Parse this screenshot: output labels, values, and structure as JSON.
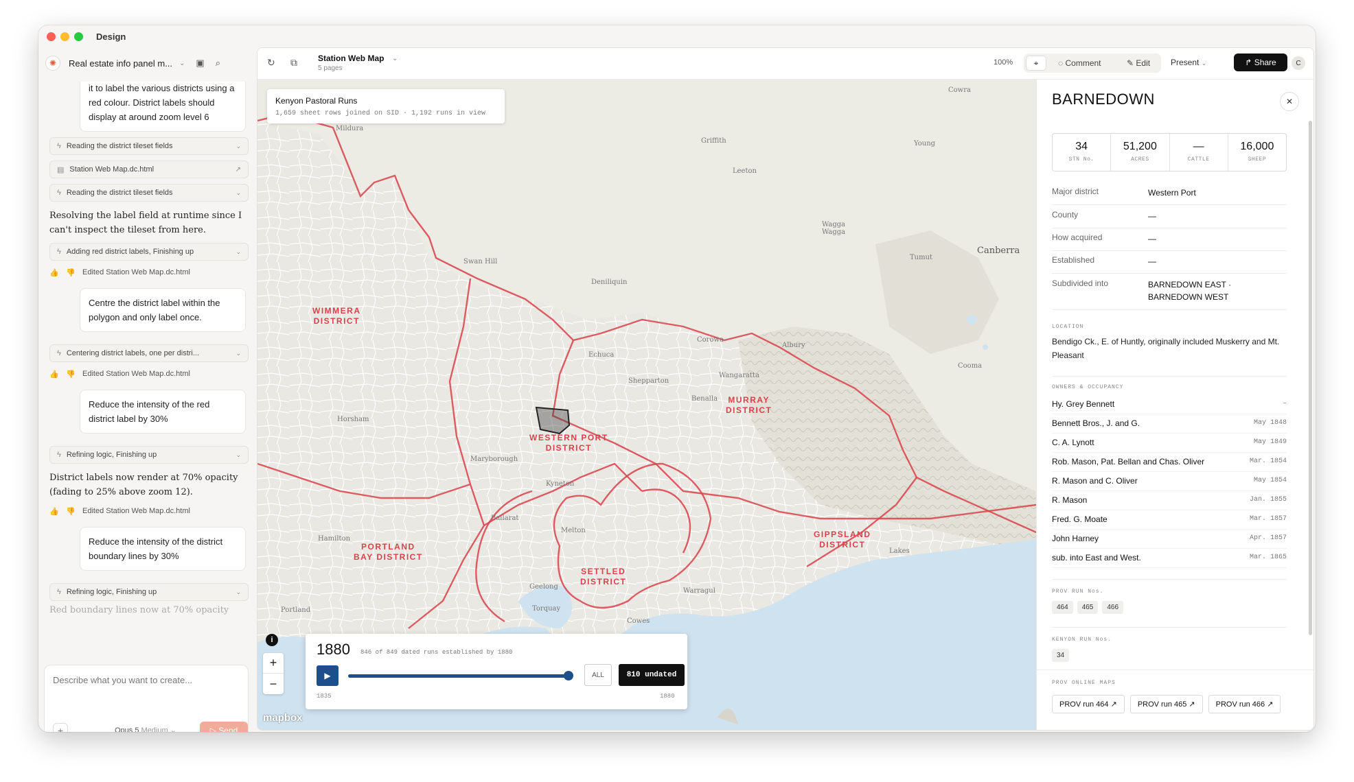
{
  "window": {
    "title": "Design"
  },
  "chat": {
    "project_title": "Real estate info panel m...",
    "messages": {
      "user1": "it to label the various districts using a red colour. District labels should display at around zoom level 6",
      "tool1": "Reading the district tileset fields",
      "file1": "Station Web Map.dc.html",
      "tool2": "Reading the district tileset fields",
      "asst1": "Resolving the label field at runtime since I can't inspect the tileset from here.",
      "tool3": "Adding red district labels, Finishing up",
      "edited1": "Edited Station Web Map.dc.html",
      "user2": "Centre the district label within the polygon and only label once.",
      "tool4": "Centering district labels, one per distri...",
      "edited2": "Edited Station Web Map.dc.html",
      "user3": "Reduce the intensity of the red district label by 30%",
      "tool5": "Refining logic, Finishing up",
      "asst2": "District labels now render at 70% opacity (fading to 25% above zoom 12).",
      "edited3": "Edited Station Web Map.dc.html",
      "user4": "Reduce the intensity of the district boundary lines by 30%",
      "tool6": "Refining logic, Finishing up",
      "asst3": "Red boundary lines now at 70% opacity"
    },
    "composer": {
      "placeholder": "Describe what you want to create...",
      "model": "Opus 5",
      "model_effort": "Medium",
      "send": "Send"
    }
  },
  "toolbar": {
    "doc_title": "Station Web Map",
    "doc_sub": "5 pages",
    "zoom": "100%",
    "comment": "Comment",
    "edit": "Edit",
    "present": "Present",
    "share": "Share",
    "avatar": "C"
  },
  "map": {
    "overlay_title": "Kenyon Pastoral Runs",
    "overlay_sub": "1,659 sheet rows joined on SID · 1,192 runs in view",
    "districts": {
      "wimmera": [
        "WIMMERA",
        "DISTRICT"
      ],
      "murray": [
        "MURRAY",
        "DISTRICT"
      ],
      "western_port": [
        "WESTERN PORT",
        "DISTRICT"
      ],
      "portland": [
        "PORTLAND",
        "BAY DISTRICT"
      ],
      "settled": [
        "SETTLED",
        "DISTRICT"
      ],
      "gippsland": [
        "GIPPSLAND",
        "DISTRICT"
      ]
    },
    "places": {
      "cowra": "Cowra",
      "griffith": "Griffith",
      "young": "Young",
      "leeton": "Leeton",
      "wagga": "Wagga\nWagga",
      "canberra": "Canberra",
      "tumut": "Tumut",
      "swan_hill": "Swan Hill",
      "deniliquin": "Deniliquin",
      "albury": "Albury",
      "shepparton": "Shepparton",
      "horsham": "Horsham",
      "maryborough": "Maryborough",
      "ballarat": "Ballarat",
      "hamilton": "Hamilton",
      "melton": "Melton",
      "geelong": "Geelong",
      "torquay": "Torquay",
      "portland": "Portland",
      "warragul": "Warragul",
      "lakes": "Lakes",
      "cooma": "Cooma",
      "cowes": "Cowes",
      "kyneton": "Kyneton",
      "benalla": "Benalla",
      "mildura": "Mildura",
      "corowa": "Corowa",
      "wangaratta": "Wangaratta",
      "echuca": "Echuca"
    },
    "timeline": {
      "year": "1880",
      "summary": "846 of 849 dated runs established by 1880",
      "all": "ALL",
      "undated": "810 undated",
      "start": "1835",
      "end": "1880",
      "progress": 1.0
    },
    "zoom_in": "+",
    "zoom_out": "−",
    "info": "i",
    "attribution": "mapbox"
  },
  "panel": {
    "title": "BARNEDOWN",
    "stats": [
      {
        "value": "34",
        "label": "STN No."
      },
      {
        "value": "51,200",
        "label": "ACRES"
      },
      {
        "value": "—",
        "label": "CATTLE"
      },
      {
        "value": "16,000",
        "label": "SHEEP"
      }
    ],
    "fields": [
      {
        "key": "Major district",
        "value": "Western Port"
      },
      {
        "key": "County",
        "value": "—"
      },
      {
        "key": "How acquired",
        "value": "—"
      },
      {
        "key": "Established",
        "value": "—"
      },
      {
        "key": "Subdivided into",
        "value": "BARNEDOWN EAST · BARNEDOWN WEST"
      }
    ],
    "location_heading": "LOCATION",
    "location": "Bendigo Ck., E. of Huntly, originally included Muskerry and Mt. Pleasant",
    "owners_heading": "OWNERS & OCCUPANCY",
    "owners": [
      {
        "name": "Hy. Grey Bennett",
        "date": "–"
      },
      {
        "name": "Bennett Bros., J. and G.",
        "date": "May 1848"
      },
      {
        "name": "C. A. Lynott",
        "date": "May 1849"
      },
      {
        "name": "Rob. Mason, Pat. Bellan and Chas. Oliver",
        "date": "Mar. 1854"
      },
      {
        "name": "R. Mason and C. Oliver",
        "date": "May 1854"
      },
      {
        "name": "R. Mason",
        "date": "Jan. 1855"
      },
      {
        "name": "Fred. G. Moate",
        "date": "Mar. 1857"
      },
      {
        "name": "John Harney",
        "date": "Apr. 1857"
      },
      {
        "name": "sub. into East and West.",
        "date": "Mar. 1865"
      }
    ],
    "prov_heading": "PROV RUN Nos.",
    "prov_runs": [
      "464",
      "465",
      "466"
    ],
    "kenyon_heading": "KENYON RUN Nos.",
    "kenyon_runs": [
      "34"
    ],
    "online_heading": "PROV ONLINE MAPS",
    "online_maps": [
      "PROV run 464 ↗",
      "PROV run 465 ↗",
      "PROV run 466 ↗"
    ]
  }
}
